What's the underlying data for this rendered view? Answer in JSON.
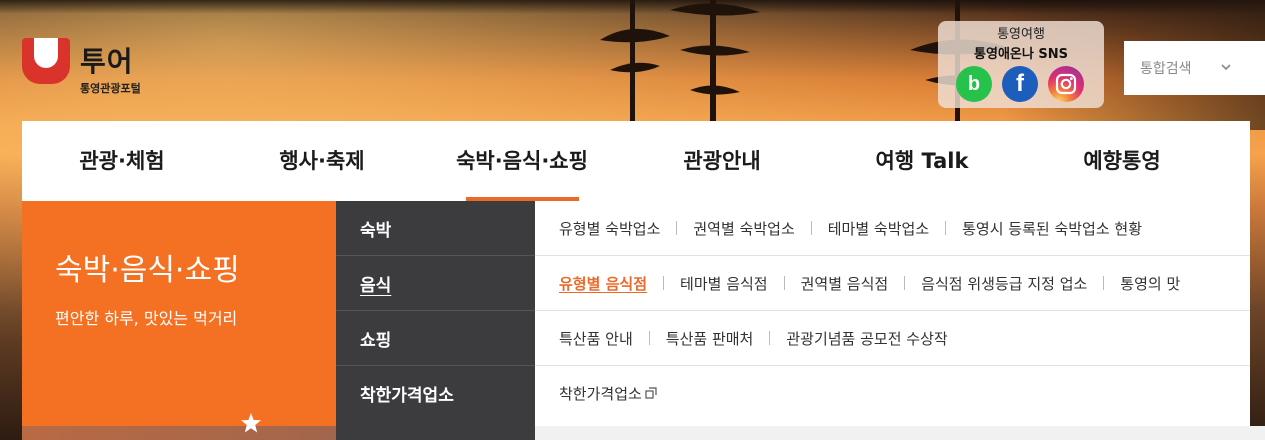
{
  "logo": {
    "name": "투어",
    "subtitle": "통영관광포털"
  },
  "sns": {
    "title": "통영여행",
    "subtitle": "통영애온나 SNS",
    "buttons": [
      {
        "icon": "blog-icon",
        "glyph": "b"
      },
      {
        "icon": "facebook-icon",
        "glyph": "f"
      },
      {
        "icon": "instagram-icon",
        "glyph": ""
      }
    ]
  },
  "search": {
    "label": "통합검색"
  },
  "nav": {
    "items": [
      "관광·체험",
      "행사·축제",
      "숙박·음식·쇼핑",
      "관광안내",
      "여행 Talk",
      "예향통영"
    ],
    "active_index": 2
  },
  "section": {
    "title": "숙박·음식·쇼핑",
    "description": "편안한 하루, 맛있는 먹거리"
  },
  "categories": [
    {
      "label": "숙박",
      "active": false,
      "links": [
        "유형별 숙박업소",
        "권역별 숙박업소",
        "테마별 숙박업소",
        "통영시 등록된 숙박업소 현황"
      ]
    },
    {
      "label": "음식",
      "active": true,
      "links": [
        "유형별 음식점",
        "테마별 음식점",
        "권역별 음식점",
        "음식점 위생등급 지정 업소",
        "통영의 맛"
      ]
    },
    {
      "label": "쇼핑",
      "active": false,
      "links": [
        "특산품 안내",
        "특산품 판매처",
        "관광기념품 공모전 수상작"
      ]
    },
    {
      "label": "착한가격업소",
      "active": false,
      "links": [
        "착한가격업소"
      ]
    }
  ],
  "colors": {
    "accent": "#f47124",
    "active_link": "#ea6a2a",
    "category_bg": "#3c3c3f",
    "blog": "#27c24c",
    "facebook": "#1d5dbb"
  }
}
